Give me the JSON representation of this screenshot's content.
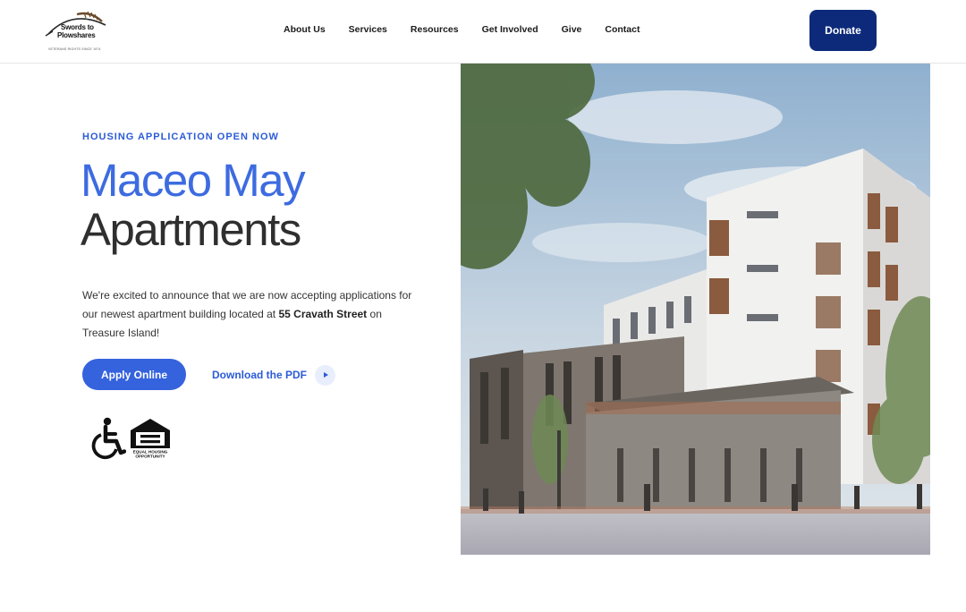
{
  "header": {
    "logo": {
      "line1": "Swords to",
      "line2": "Plowshares",
      "tagline": "VETERANS RIGHTS SINCE 1974"
    },
    "nav": [
      {
        "label": "About Us"
      },
      {
        "label": "Services"
      },
      {
        "label": "Resources"
      },
      {
        "label": "Get Involved"
      },
      {
        "label": "Give"
      },
      {
        "label": "Contact"
      }
    ],
    "donate_label": "Donate"
  },
  "hero": {
    "eyebrow": "HOUSING APPLICATION OPEN NOW",
    "title_line1": "Maceo May",
    "title_line2": "Apartments",
    "intro_before": "We're excited to announce that we are now accepting applications for our newest apartment building located at ",
    "intro_bold": "55 Cravath Street",
    "intro_after": " on Treasure Island!",
    "apply_label": "Apply Online",
    "pdf_label": "Download the PDF",
    "eho_label_line1": "EQUAL HOUSING",
    "eho_label_line2": "OPPORTUNITY",
    "icons": [
      "wheelchair-accessibility-icon",
      "equal-housing-opportunity-icon"
    ]
  },
  "colors": {
    "accent": "#3563dd",
    "accent_text": "#2c5bd6",
    "donate_bg": "#0d2a7a",
    "title_dark": "#2f2f2f"
  }
}
